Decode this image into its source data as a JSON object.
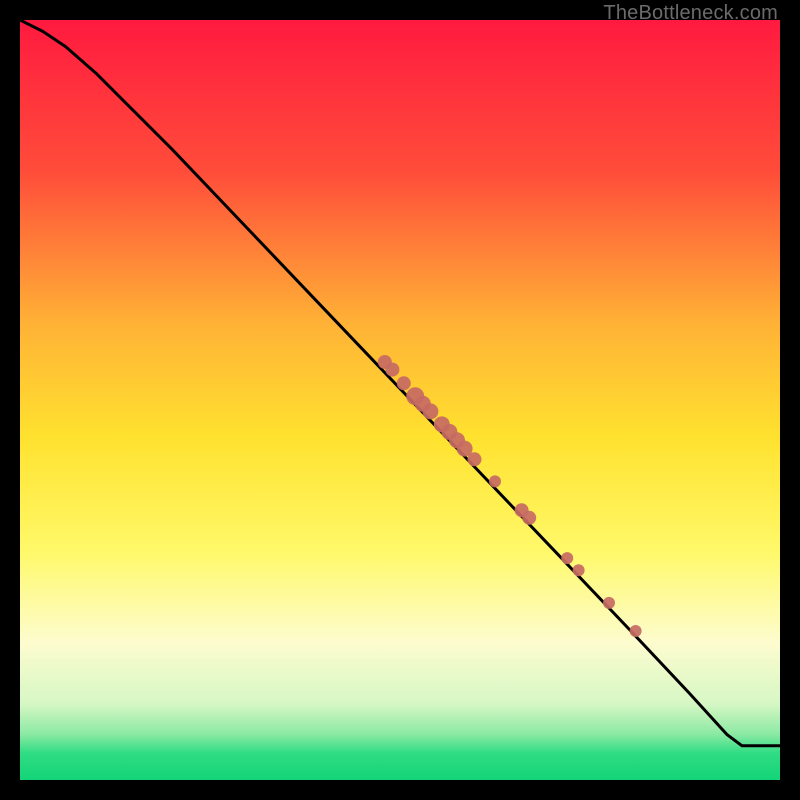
{
  "watermark": "TheBottleneck.com",
  "chart_data": {
    "type": "line",
    "title": "",
    "xlabel": "",
    "ylabel": "",
    "xlim": [
      0,
      100
    ],
    "ylim": [
      0,
      100
    ],
    "gradient_stops": [
      {
        "offset": 0.0,
        "color": "#ff1a3f"
      },
      {
        "offset": 0.2,
        "color": "#ff4d3a"
      },
      {
        "offset": 0.4,
        "color": "#ffb236"
      },
      {
        "offset": 0.55,
        "color": "#ffe22f"
      },
      {
        "offset": 0.7,
        "color": "#fff96a"
      },
      {
        "offset": 0.82,
        "color": "#fdfccf"
      },
      {
        "offset": 0.9,
        "color": "#d6f7c4"
      },
      {
        "offset": 0.94,
        "color": "#8ae9a3"
      },
      {
        "offset": 0.965,
        "color": "#2fdc84"
      },
      {
        "offset": 1.0,
        "color": "#14d477"
      }
    ],
    "series": [
      {
        "name": "curve",
        "x": [
          0,
          3,
          6,
          10,
          15,
          20,
          30,
          40,
          50,
          60,
          70,
          80,
          88,
          93,
          95,
          100
        ],
        "y": [
          100,
          98.5,
          96.5,
          93,
          88,
          83,
          72.5,
          62,
          51.5,
          41,
          30.5,
          20,
          11.5,
          6,
          4.5,
          4.5
        ]
      }
    ],
    "scatter": {
      "name": "highlighted-points",
      "color": "#c76a63",
      "points": [
        {
          "x": 48,
          "y": 55,
          "r": 7
        },
        {
          "x": 49,
          "y": 54,
          "r": 7
        },
        {
          "x": 50.5,
          "y": 52.2,
          "r": 7
        },
        {
          "x": 52,
          "y": 50.5,
          "r": 9
        },
        {
          "x": 53,
          "y": 49.5,
          "r": 8
        },
        {
          "x": 54,
          "y": 48.5,
          "r": 8
        },
        {
          "x": 55.5,
          "y": 46.8,
          "r": 8
        },
        {
          "x": 56.5,
          "y": 45.8,
          "r": 8
        },
        {
          "x": 57.5,
          "y": 44.7,
          "r": 8
        },
        {
          "x": 58.5,
          "y": 43.6,
          "r": 8
        },
        {
          "x": 59.8,
          "y": 42.2,
          "r": 7
        },
        {
          "x": 62.5,
          "y": 39.3,
          "r": 6
        },
        {
          "x": 66,
          "y": 35.5,
          "r": 7
        },
        {
          "x": 67,
          "y": 34.5,
          "r": 7
        },
        {
          "x": 72,
          "y": 29.2,
          "r": 6
        },
        {
          "x": 73.5,
          "y": 27.6,
          "r": 6
        },
        {
          "x": 77.5,
          "y": 23.3,
          "r": 6
        },
        {
          "x": 81,
          "y": 19.6,
          "r": 6
        }
      ]
    }
  }
}
